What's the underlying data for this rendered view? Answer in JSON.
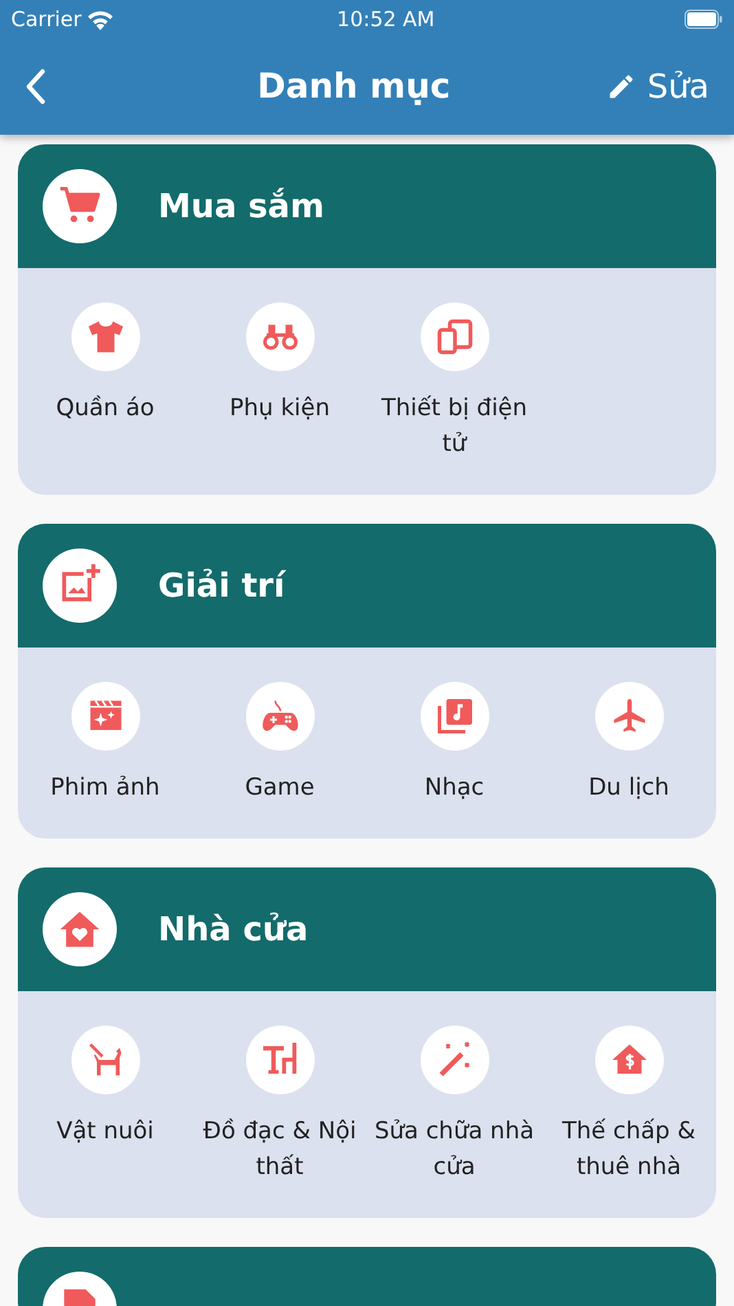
{
  "status_bar": {
    "carrier": "Carrier",
    "time": "10:52 AM"
  },
  "nav_bar": {
    "title": "Danh mục",
    "edit_label": "Sửa"
  },
  "categories": [
    {
      "kind": "group",
      "title": "Mua sắm",
      "items": [
        {
          "label": "Quần áo"
        },
        {
          "label": "Phụ kiện"
        },
        {
          "label": "Thiết bị điện tử"
        }
      ]
    },
    {
      "kind": "group",
      "title": "Giải trí",
      "items": [
        {
          "label": "Phim ảnh"
        },
        {
          "label": "Game"
        },
        {
          "label": "Nhạc"
        },
        {
          "label": "Du lịch"
        }
      ]
    },
    {
      "kind": "group",
      "title": "Nhà cửa",
      "items": [
        {
          "label": "Vật nuôi"
        },
        {
          "label": "Đồ đạc & Nội thất"
        },
        {
          "label": "Sửa chữa nhà cửa"
        },
        {
          "label": "Thế chấp & thuê nhà"
        }
      ]
    },
    {
      "kind": "cut-off"
    }
  ]
}
